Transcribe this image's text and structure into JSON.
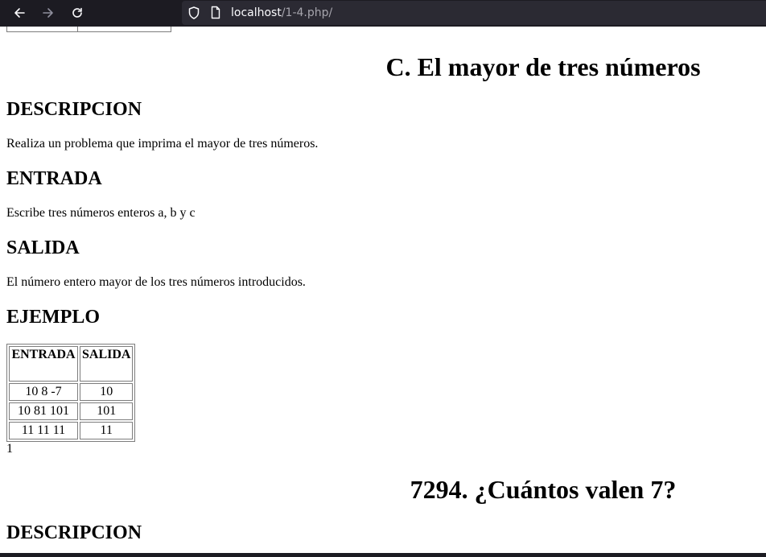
{
  "browser": {
    "url_host": "localhost",
    "url_path": "/1-4.php/",
    "icons": {
      "back": "back-arrow-icon",
      "forward": "forward-arrow-icon",
      "reload": "reload-icon",
      "tracking": "shield-icon",
      "page": "page-icon"
    },
    "colors": {
      "toolbar": "#1c1b22",
      "urlbar": "#2b2a33"
    }
  },
  "page": {
    "problem_c": {
      "title": "C. El mayor de tres números",
      "descripcion_heading": "DESCRIPCION",
      "descripcion_text": "Realiza un problema que imprima el mayor de tres números.",
      "entrada_heading": "ENTRADA",
      "entrada_text": "Escribe tres números enteros a, b y c",
      "salida_heading": "SALIDA",
      "salida_text": "El número entero mayor de los tres números introducidos.",
      "ejemplo_heading": "EJEMPLO",
      "table": {
        "headers": [
          "ENTRADA",
          "SALIDA"
        ],
        "rows": [
          [
            "10 8 -7",
            "10"
          ],
          [
            "10 81 101",
            "101"
          ],
          [
            "11 11 11",
            "11"
          ]
        ]
      },
      "output": "1"
    },
    "problem_7294": {
      "title": "7294. ¿Cuántos valen 7?",
      "descripcion_heading": "DESCRIPCION"
    }
  }
}
